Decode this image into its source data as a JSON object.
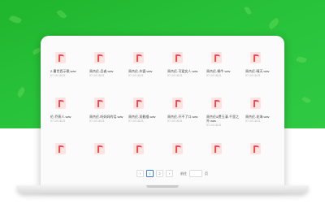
{
  "files": [
    {
      "name": "2-曹世西示歌.wav",
      "date": "07-19 18:21"
    },
    {
      "name": "周杰伦-忍者.wav",
      "date": "07-19 18:21"
    },
    {
      "name": "周杰伦-外婆.wav",
      "date": "07-19 18:21"
    },
    {
      "name": "周杰伦-可爱女人.wav",
      "date": "07-19 18:21"
    },
    {
      "name": "周杰伦-蜗牛.wav",
      "date": "07-19 18:21"
    },
    {
      "name": "周杰伦-晴天.wav",
      "date": "07-19 18:21"
    },
    {
      "name": "伦-乔燕人.wav",
      "date": "07-19 18:21"
    },
    {
      "name": "周杰伦-听妈妈的话.wav",
      "date": "07-19 18:21"
    },
    {
      "name": "周杰伦-双截棍.wav",
      "date": "07-19 18:21"
    },
    {
      "name": "周杰伦-开不了口.wav",
      "date": "07-19 18:21"
    },
    {
      "name": "周杰伦&费玉清-千里之外.wav",
      "date": "07-19 18:21"
    },
    {
      "name": "周杰伦-花海.wav",
      "date": "07-19 18:21"
    },
    {
      "name": "",
      "date": ""
    },
    {
      "name": "",
      "date": ""
    },
    {
      "name": "",
      "date": ""
    },
    {
      "name": "",
      "date": ""
    },
    {
      "name": "",
      "date": ""
    },
    {
      "name": "",
      "date": ""
    }
  ],
  "pagination": {
    "prev": "‹",
    "pages": [
      "1",
      "2"
    ],
    "next": "›",
    "goto_label": "前往",
    "page_suffix": "页"
  },
  "colors": {
    "accent": "#3a7bd5",
    "background_green": "#28c23a",
    "file_icon": "#ee4d4d"
  }
}
